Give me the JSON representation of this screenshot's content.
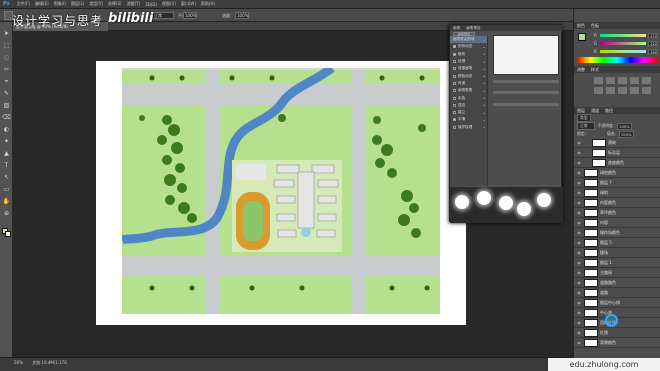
{
  "app": {
    "logo": "Ps"
  },
  "menu": [
    "文件(F)",
    "编辑(E)",
    "图像(I)",
    "图层(L)",
    "类型(Y)",
    "选择(S)",
    "滤镜(T)",
    "3D(D)",
    "视图(V)",
    "窗口(W)",
    "帮助(H)"
  ],
  "options": {
    "size": "161",
    "mode_label": "模式:",
    "mode": "正常",
    "opacity_label": "不透明度:",
    "opacity": "100%",
    "flow_label": "流量:",
    "flow": "100%",
    "workspace": "基本功能"
  },
  "watermark": {
    "title": "设计学习与思考",
    "brand": "bilibili",
    "site": "edu.zhulong.com"
  },
  "document_tab": "总平面.jpg @ 50% (RGB/8)",
  "status": {
    "zoom": "50%",
    "doc": "文档:19.4M/1.17G"
  },
  "colors": {
    "accent": "#33a6ff",
    "grass": "#b5e08d",
    "road": "#c9cccf",
    "river": "#4f87c6",
    "track": "#d99a2e",
    "tree": "#3d7a1c"
  },
  "color_panel": {
    "tabs": [
      "颜色",
      "色板"
    ],
    "r": "172",
    "g": "222",
    "b": "142"
  },
  "adjust_panel": {
    "tabs": [
      "调整",
      "样式"
    ]
  },
  "brush_panel": {
    "tabs": [
      "画笔",
      "画笔预设"
    ],
    "preset_button": "画笔预设",
    "items": [
      {
        "label": "画笔笔尖形状",
        "checked": false,
        "selected": true
      },
      {
        "label": "形状动态",
        "checked": true,
        "selected": false
      },
      {
        "label": "散布",
        "checked": true,
        "selected": false
      },
      {
        "label": "纹理",
        "checked": false,
        "selected": false
      },
      {
        "label": "双重画笔",
        "checked": false,
        "selected": false
      },
      {
        "label": "颜色动态",
        "checked": false,
        "selected": false
      },
      {
        "label": "传递",
        "checked": false,
        "selected": false
      },
      {
        "label": "画笔笔势",
        "checked": false,
        "selected": false
      },
      {
        "label": "杂色",
        "checked": false,
        "selected": false
      },
      {
        "label": "湿边",
        "checked": false,
        "selected": false
      },
      {
        "label": "建立",
        "checked": false,
        "selected": false
      },
      {
        "label": "平滑",
        "checked": true,
        "selected": false
      },
      {
        "label": "保护纹理",
        "checked": false,
        "selected": false
      }
    ]
  },
  "layers_panel": {
    "tabs": [
      "图层",
      "通道",
      "路径"
    ],
    "kind": "类型",
    "blend": "正常",
    "opacity_label": "不透明度:",
    "opacity": "100%",
    "lock_label": "锁定:",
    "fill_label": "填充:",
    "fill": "100%",
    "layers": [
      {
        "name": "建筑",
        "indent": true
      },
      {
        "name": "标志层",
        "indent": true
      },
      {
        "name": "底座颜色",
        "indent": true
      },
      {
        "name": "绿地颜色",
        "indent": false
      },
      {
        "name": "图层 7",
        "indent": false
      },
      {
        "name": "绿地",
        "indent": false
      },
      {
        "name": "内容颜色",
        "indent": false
      },
      {
        "name": "草坪颜色",
        "indent": false
      },
      {
        "name": "内容",
        "indent": false
      },
      {
        "name": "操作场颜色",
        "indent": false
      },
      {
        "name": "图层 5",
        "indent": false
      },
      {
        "name": "操场",
        "indent": false
      },
      {
        "name": "图层 1",
        "indent": false
      },
      {
        "name": "主路网",
        "indent": false
      },
      {
        "name": "道路路色",
        "indent": false
      },
      {
        "name": "道路",
        "indent": false
      },
      {
        "name": "图层中心线",
        "indent": false
      },
      {
        "name": "中心线",
        "indent": false
      },
      {
        "name": "用地红线",
        "indent": false
      },
      {
        "name": "红线",
        "indent": false
      },
      {
        "name": "背景颜色",
        "indent": false
      }
    ]
  }
}
